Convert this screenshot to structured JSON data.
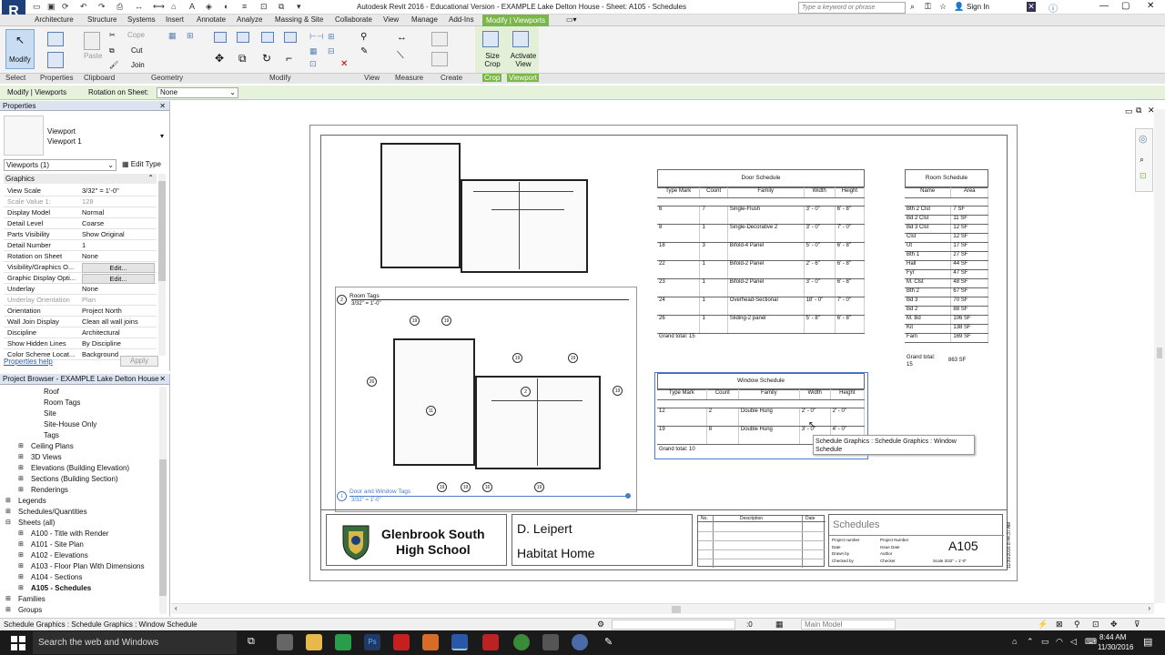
{
  "app": {
    "logo_letter": "R",
    "title": "Autodesk Revit 2016 - Educational Version -   EXAMPLE Lake Delton House - Sheet: A105 - Schedules",
    "search_placeholder": "Type a keyword or phrase",
    "sign_in": "Sign In"
  },
  "tabs": [
    "Architecture",
    "Structure",
    "Systems",
    "Insert",
    "Annotate",
    "Analyze",
    "Massing & Site",
    "Collaborate",
    "View",
    "Manage",
    "Add-Ins",
    "Modify | Viewports"
  ],
  "ribbon": {
    "modify_label": "Modify",
    "paste_label": "Paste",
    "cope": "Cope",
    "cut": "Cut",
    "join": "Join",
    "size_crop": "Size Crop",
    "activate_view": "Activate View",
    "panels": [
      "Select",
      "Properties",
      "Clipboard",
      "Geometry",
      "Modify",
      "View",
      "Measure",
      "Create",
      "Crop",
      "Viewport"
    ]
  },
  "options_bar": {
    "context": "Modify | Viewports",
    "rotation_label": "Rotation on Sheet:",
    "rotation_value": "None"
  },
  "properties": {
    "title": "Properties",
    "type_line1": "Viewport",
    "type_line2": "Viewport 1",
    "instance_filter": "Viewports (1)",
    "edit_type": "Edit Type",
    "group": "Graphics",
    "rows": [
      {
        "k": "View Scale",
        "v": "3/32\" = 1'-0\""
      },
      {
        "k": "Scale Value    1:",
        "v": "128"
      },
      {
        "k": "Display Model",
        "v": "Normal"
      },
      {
        "k": "Detail Level",
        "v": "Coarse"
      },
      {
        "k": "Parts Visibility",
        "v": "Show Original"
      },
      {
        "k": "Detail Number",
        "v": "1"
      },
      {
        "k": "Rotation on Sheet",
        "v": "None"
      },
      {
        "k": "Visibility/Graphics O...",
        "v": "Edit..."
      },
      {
        "k": "Graphic Display Opti...",
        "v": "Edit..."
      },
      {
        "k": "Underlay",
        "v": "None"
      },
      {
        "k": "Underlay Orientation",
        "v": "Plan"
      },
      {
        "k": "Orientation",
        "v": "Project North"
      },
      {
        "k": "Wall Join Display",
        "v": "Clean all wall joins"
      },
      {
        "k": "Discipline",
        "v": "Architectural"
      },
      {
        "k": "Show Hidden Lines",
        "v": "By Discipline"
      },
      {
        "k": "Color Scheme Locat...",
        "v": "Background"
      }
    ],
    "help": "Properties help",
    "apply": "Apply"
  },
  "browser": {
    "title": "Project Browser - EXAMPLE Lake Delton House",
    "items": [
      "Roof",
      "Room Tags",
      "Site",
      "Site-House Only",
      "Tags",
      "Ceiling Plans",
      "3D Views",
      "Elevations (Building Elevation)",
      "Sections (Building Section)",
      "Renderings",
      "Legends",
      "Schedules/Quantities",
      "Sheets (all)",
      "A100 - Title with Render",
      "A101 - Site Plan",
      "A102 - Elevations",
      "A103 - Floor Plan With Dimensions",
      "A104 - Sections",
      "A105 - Schedules",
      "Families",
      "Groups"
    ]
  },
  "sheet": {
    "view1_title": "Room Tags",
    "view1_num": "2",
    "view1_scale": "3/32\" = 1'-0\"",
    "view2_title": "Door and Window Tags",
    "view2_num": "1",
    "view2_scale": "3/32\" = 1'-0\"",
    "school_line1": "Glenbrook South",
    "school_line2": "High School",
    "author": "D. Leipert",
    "project": "Habitat Home",
    "sheet_name": "Schedules",
    "sheet_number": "A105",
    "rev_headers": [
      "No.",
      "Description",
      "Date"
    ],
    "tb_labels": [
      "Project number",
      "Date",
      "Drawn by",
      "Checked by"
    ],
    "tb_values": [
      "Project Number",
      "Issue Date",
      "Author",
      "Checker"
    ],
    "tb_scale": "Scale   3/32\" = 1'-0\"",
    "timestamp": "11/30/2016 8:44:37 AM"
  },
  "door_schedule": {
    "title": "Door Schedule",
    "headers": [
      "Type Mark",
      "Count",
      "Family",
      "Width",
      "Height"
    ],
    "rows": [
      [
        "6",
        "7",
        "Single-Flush",
        "3' - 0\"",
        "6' - 8\""
      ],
      [
        "8",
        "1",
        "Single-Decorative 2",
        "3' - 0\"",
        "7' - 0\""
      ],
      [
        "18",
        "3",
        "Bifold-4 Panel",
        "5' - 0\"",
        "6' - 8\""
      ],
      [
        "22",
        "1",
        "Bifold-2 Panel",
        "2' - 6\"",
        "6' - 8\""
      ],
      [
        "23",
        "1",
        "Bifold-2 Panel",
        "3' - 0\"",
        "6' - 8\""
      ],
      [
        "24",
        "1",
        "Overhead-Sectional",
        "18' - 0\"",
        "7' - 0\""
      ],
      [
        "26",
        "1",
        "Sliding-2 panel",
        "5' - 8\"",
        "6' - 8\""
      ]
    ],
    "grand_total": "Grand total: 15"
  },
  "window_schedule": {
    "title": "Window Schedule",
    "headers": [
      "Type Mark",
      "Count",
      "Family",
      "Width",
      "Height"
    ],
    "rows": [
      [
        "12",
        "2",
        "Double Hung",
        "2' - 0\"",
        "2' - 0\""
      ],
      [
        "19",
        "8",
        "Double Hung",
        "3' - 0\"",
        "4' - 0\""
      ]
    ],
    "grand_total": "Grand total: 10",
    "tooltip": "Schedule Graphics : Schedule Graphics : Window Schedule"
  },
  "room_schedule": {
    "title": "Room Schedule",
    "headers": [
      "Name",
      "Area"
    ],
    "rows": [
      [
        "Bth 2 Clst",
        "7 SF"
      ],
      [
        "Bd 2 Clst",
        "11 SF"
      ],
      [
        "Bd 3 Clst",
        "12 SF"
      ],
      [
        "Clst",
        "12 SF"
      ],
      [
        "Ut",
        "17 SF"
      ],
      [
        "Bth 1",
        "27 SF"
      ],
      [
        "Hall",
        "44 SF"
      ],
      [
        "Fyr",
        "47 SF"
      ],
      [
        "M. Clst",
        "48 SF"
      ],
      [
        "Bth 2",
        "67 SF"
      ],
      [
        "Bd 3",
        "70 SF"
      ],
      [
        "Bd 2",
        "88 SF"
      ],
      [
        "M. Bd",
        "106 SF"
      ],
      [
        "Kit",
        "138 SF"
      ],
      [
        "Fam",
        "169 SF"
      ]
    ],
    "grand_total_label": "Grand total: 15",
    "grand_total_value": "863 SF"
  },
  "status": {
    "text": "Schedule Graphics : Schedule Graphics : Window Schedule",
    "zero": ":0",
    "model": "Main Model"
  },
  "taskbar": {
    "search": "Search the web and Windows",
    "time": "8:44 AM",
    "date": "11/30/2016"
  }
}
